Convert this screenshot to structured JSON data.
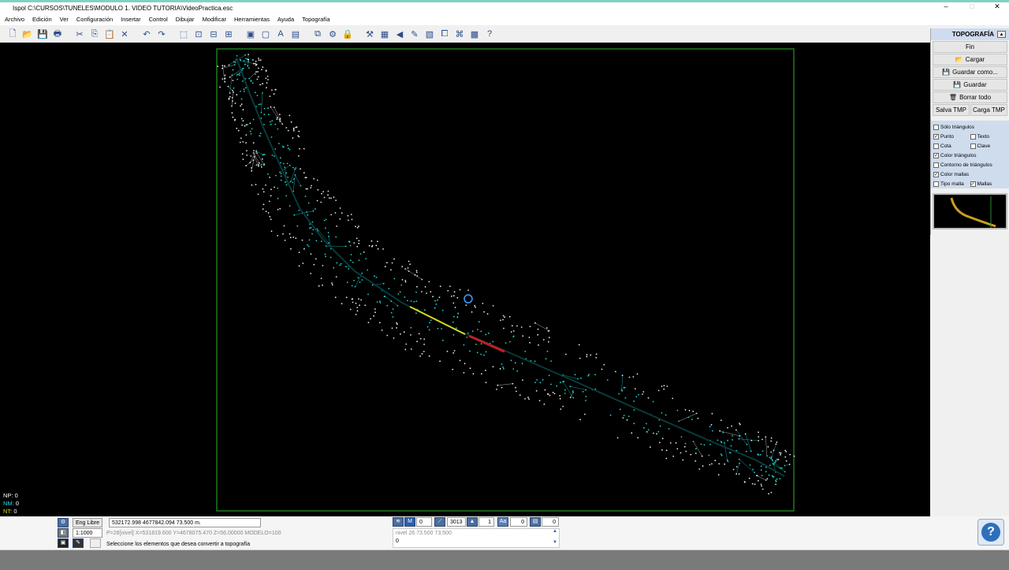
{
  "window": {
    "title": "Ispol  C:\\CURSOS\\TUNELES\\MODULO 1. VIDEO TUTORIA\\VideoPractica.esc",
    "minimize": "–",
    "maximize": "□",
    "close": "✕"
  },
  "menu": [
    "Archivo",
    "Edición",
    "Ver",
    "Configuración",
    "Insertar",
    "Control",
    "Dibujar",
    "Modificar",
    "Herramientas",
    "Ayuda",
    "Topografía"
  ],
  "toolbar_icons": [
    "new-file-icon",
    "open-folder-icon",
    "save-icon",
    "print-icon",
    "sep",
    "cut-icon",
    "copy-icon",
    "paste-icon",
    "delete-icon",
    "sep",
    "undo-icon",
    "redo-icon",
    "sep",
    "zoom-window-icon",
    "zoom-extents-icon",
    "zoom-previous-icon",
    "zoom-all-icon",
    "sep",
    "view-1-icon",
    "view-2-icon",
    "view-text-icon",
    "view-4-icon",
    "sep",
    "layers-icon",
    "properties-icon",
    "lock-icon",
    "sep",
    "measure-icon",
    "image-icon",
    "arrow-left-icon",
    "pencil-icon",
    "block-icon",
    "copy-window-icon",
    "tree-icon",
    "grid-icon",
    "help-cursor-icon"
  ],
  "side_panel": {
    "title": "TOPOGRAFÍA",
    "buttons": {
      "fin": "Fin",
      "cargar": "Cargar",
      "guardar_como": "Guardar como...",
      "guardar": "Guardar",
      "borrar_todo": "Borrar todo",
      "salva_tmp": "Salva TMP",
      "carga_tmp": "Carga TMP"
    },
    "checks": {
      "solo_triangulos": "Sólo triángulos",
      "punto": "Punto",
      "texto": "Texto",
      "cota": "Cota",
      "clave": "Clave",
      "color_triangulos": "Color triángulos",
      "contorno_triangulos": "Contorno de triángulos",
      "color_mallas": "Color mallas",
      "tipo_malla": "Tipo malla",
      "mallas": "Mallas"
    },
    "check_state": {
      "solo_triangulos": false,
      "punto": true,
      "texto": false,
      "cota": false,
      "clave": false,
      "color_triangulos": true,
      "contorno_triangulos": false,
      "color_mallas": true,
      "tipo_malla": false,
      "mallas": true
    }
  },
  "counters": {
    "np_label": "NP:",
    "np": "0",
    "nm_label": "NM:",
    "nm": "0",
    "nt_label": "NT:",
    "nt": "0"
  },
  "status": {
    "snap_mode": "Eng Libre",
    "scale": "1:1000",
    "coords": "532172.998  4677842.094   73.500       m.",
    "point_info": "P=28[nivel] X=531819.600 Y=4678075.470 Z=56.00000 MODELO=100",
    "prompt": "Seleccione los elementos que desea convertir a topografía",
    "field1": "0",
    "field2": "3013",
    "field3": "1",
    "field4": "0",
    "field5": "0",
    "nivel_info": "nivel 26 73.500 73.500",
    "input_value": "0"
  },
  "colors": {
    "mesh_white": "#e8e8e8",
    "mesh_cyan": "#22d3d3",
    "frame_green": "#1e7a1e",
    "axis_dark": "#0a3a3a",
    "highlight_yellow": "#d8d820",
    "highlight_red": "#c02020"
  }
}
